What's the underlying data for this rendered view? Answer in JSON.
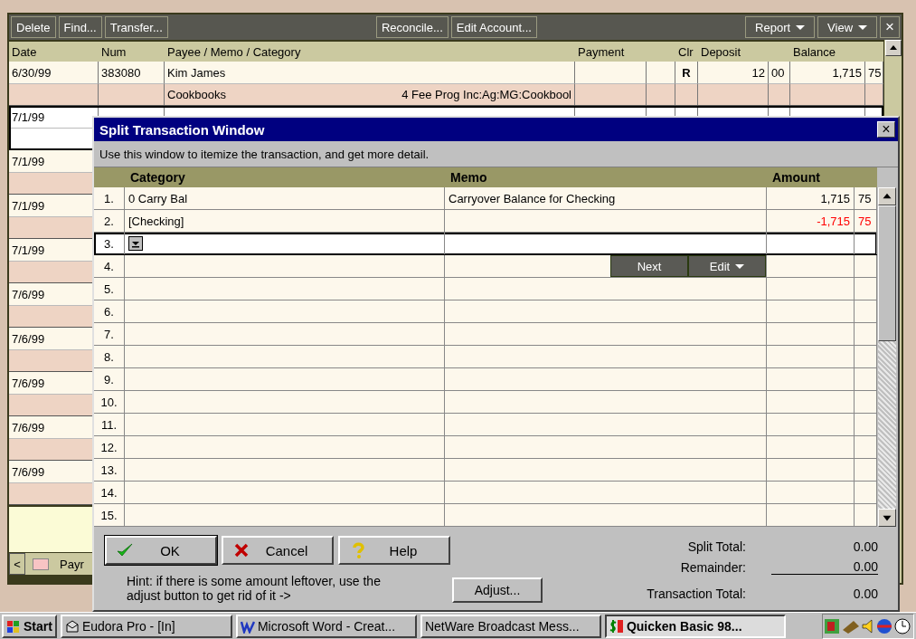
{
  "register": {
    "toolbar_left": [
      {
        "label": "Delete",
        "menu": false
      },
      {
        "label": "Find...",
        "menu": false
      },
      {
        "label": "Transfer...",
        "menu": false
      }
    ],
    "toolbar_center": [
      {
        "label": "Reconcile...",
        "menu": false
      },
      {
        "label": "Edit Account...",
        "menu": false
      }
    ],
    "toolbar_right": [
      {
        "label": "Report",
        "menu": true
      },
      {
        "label": "View",
        "menu": true
      }
    ],
    "close": "×",
    "columns": {
      "date": "Date",
      "num": "Num",
      "payee": "Payee / Memo / Category",
      "payment": "Payment",
      "clr": "Clr",
      "deposit": "Deposit",
      "balance": "Balance"
    },
    "rows": [
      {
        "date": "6/30/99",
        "num": "383080",
        "payee": "Kim James",
        "category": "Cookbooks",
        "category_detail": "4 Fee Prog Inc:Ag:MG:Cookbool",
        "clr": "R",
        "deposit": "12",
        "deposit_cents": "00",
        "balance": "1,715",
        "balance_cents": "75",
        "selected": false
      },
      {
        "date": "7/1/99",
        "selected": true
      },
      {
        "date": "7/1/99",
        "selected": false
      },
      {
        "date": "7/1/99",
        "selected": false
      },
      {
        "date": "7/1/99",
        "selected": false
      },
      {
        "date": "7/6/99",
        "selected": false
      },
      {
        "date": "7/6/99",
        "selected": false
      },
      {
        "date": "7/6/99",
        "selected": false
      },
      {
        "date": "7/6/99",
        "selected": false
      },
      {
        "date": "7/6/99",
        "selected": false
      }
    ],
    "tab_scroll": "<",
    "account_tab": "Payr"
  },
  "split_window": {
    "title": "Split Transaction Window",
    "close": "×",
    "instructions": "Use this window to itemize the transaction, and get more detail.",
    "columns": {
      "category": "Category",
      "memo": "Memo",
      "amount": "Amount"
    },
    "lines": [
      {
        "number": "1.",
        "category": "0 Carry Bal",
        "memo": "Carryover Balance for Checking",
        "amount": "1,715",
        "cents": "75",
        "negative": false,
        "editing": false
      },
      {
        "number": "2.",
        "category": "[Checking]",
        "amount": "-1,715",
        "cents": "75",
        "negative": true,
        "editing": false
      },
      {
        "number": "3.",
        "editing": true
      },
      {
        "number": "4.",
        "editing": false,
        "buttons": [
          {
            "label": "Next",
            "menu": false
          },
          {
            "label": "Edit",
            "menu": true
          }
        ]
      },
      {
        "number": "5.",
        "editing": false
      },
      {
        "number": "6.",
        "editing": false
      },
      {
        "number": "7.",
        "editing": false
      },
      {
        "number": "8.",
        "editing": false
      },
      {
        "number": "9.",
        "editing": false
      },
      {
        "number": "10.",
        "editing": false
      },
      {
        "number": "11.",
        "editing": false
      },
      {
        "number": "12.",
        "editing": false
      },
      {
        "number": "13.",
        "editing": false
      },
      {
        "number": "14.",
        "editing": false
      },
      {
        "number": "15.",
        "editing": false
      }
    ],
    "buttons": [
      {
        "label": "OK",
        "kind": "ok"
      },
      {
        "label": "Cancel",
        "kind": "cancel"
      },
      {
        "label": "Help",
        "kind": "help"
      }
    ],
    "hint": "Hint: if there is some amount leftover, use the adjust button to get rid of it ->",
    "adjust": "Adjust...",
    "totals": [
      {
        "label": "Split Total:",
        "value": "0.00"
      },
      {
        "label": "Remainder:",
        "value": "0.00"
      },
      {
        "label": "Transaction Total:",
        "value": "0.00"
      }
    ]
  },
  "taskbar": {
    "start": "Start",
    "tasks": [
      {
        "label": "Eudora Pro - [In]",
        "selected": false
      },
      {
        "label": "Microsoft Word - Creat...",
        "selected": false
      },
      {
        "label": "NetWare Broadcast Mess...",
        "selected": false
      },
      {
        "label": "Quicken Basic 98...",
        "selected": true
      }
    ]
  }
}
